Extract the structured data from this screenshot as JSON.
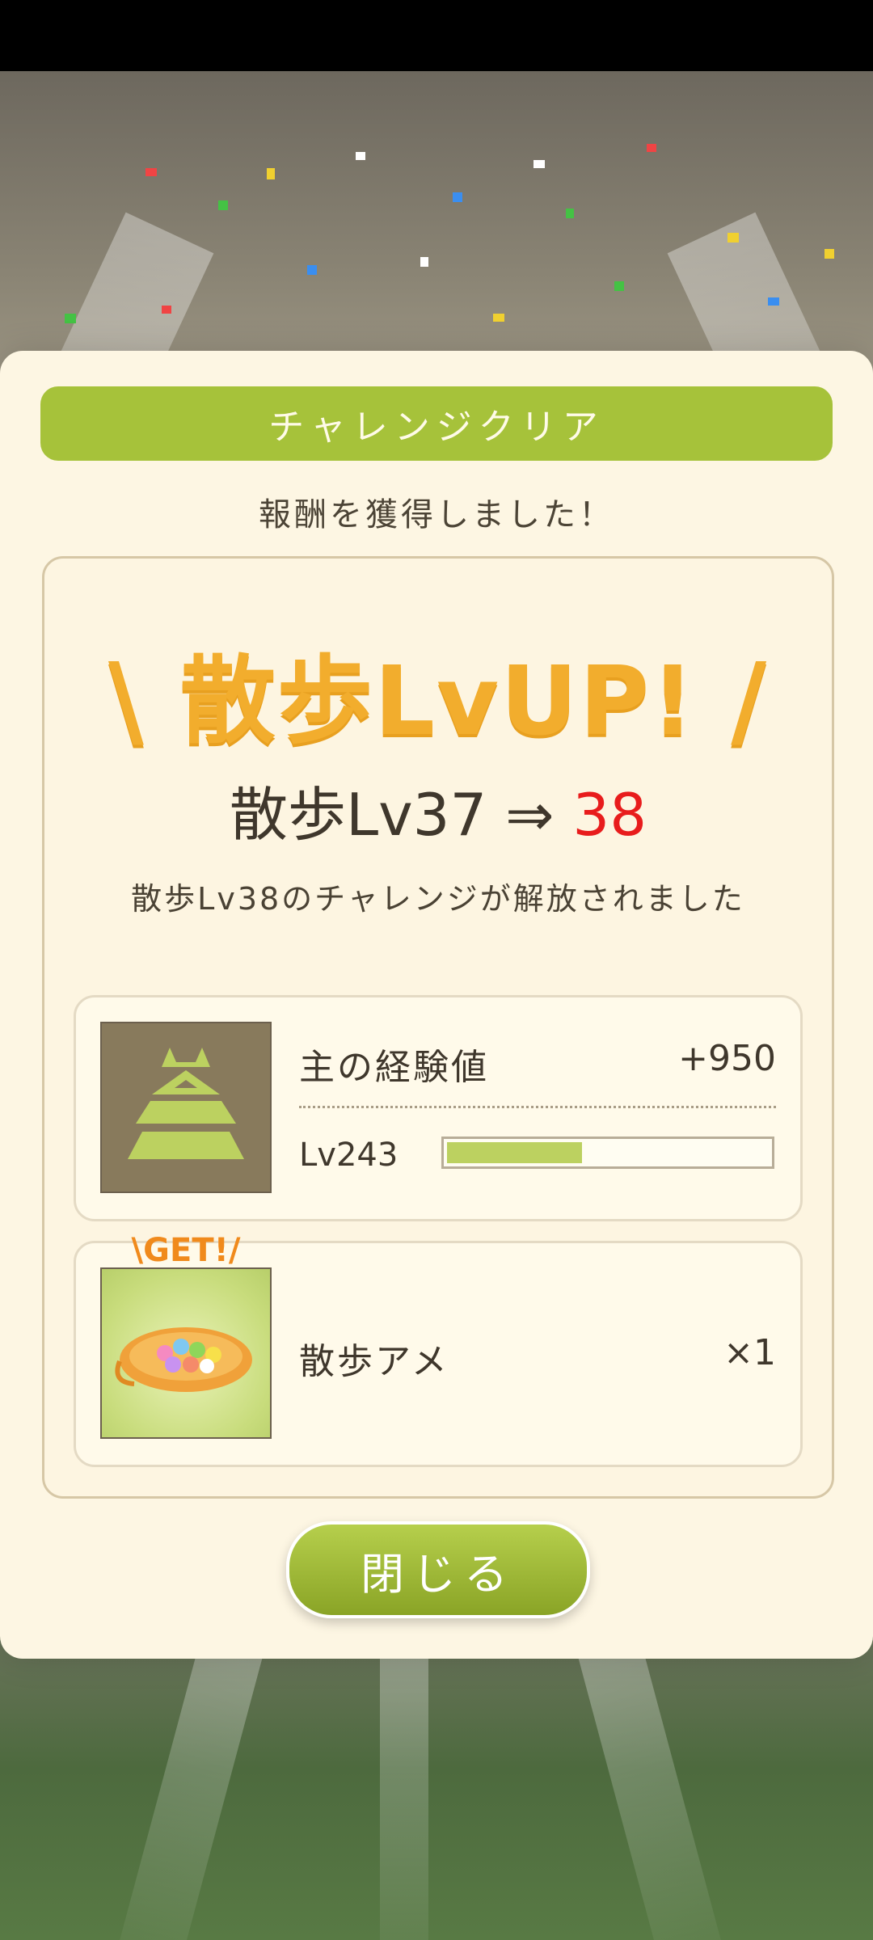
{
  "dialog": {
    "title": "チャレンジクリア",
    "subtitle": "報酬を獲得しました！",
    "lvup_banner": "散歩LvUP!",
    "level_change": {
      "prefix": "散歩Lv37 ⇒ ",
      "new_level": "38"
    },
    "unlock_message": "散歩Lv38のチャレンジが解放されました",
    "rewards": [
      {
        "label": "主の経験値",
        "value": "+950",
        "level": "Lv243",
        "progress_percent": 42
      },
      {
        "badge": "\\GET!/",
        "label": "散歩アメ",
        "value": "×1"
      }
    ],
    "close_label": "閉じる"
  },
  "colors": {
    "accent_green": "#a6c23a",
    "lvup_orange": "#f2ad2d",
    "new_level_red": "#e81c1c"
  },
  "icons": [
    "castle-icon",
    "candy-icon"
  ]
}
